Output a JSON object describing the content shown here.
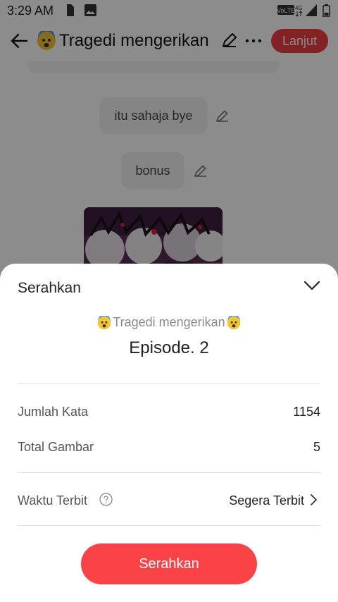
{
  "status_bar": {
    "time": "3:29 AM",
    "icons": [
      "sim-card-icon",
      "image-icon",
      "volte-icon",
      "4g-icon",
      "signal-icon",
      "battery-icon"
    ]
  },
  "header": {
    "title_emoji": "fearful-face-emoji",
    "title": "Tragedi mengerikan",
    "next_label": "Lanjut",
    "accent_color": "#ef3e44"
  },
  "content": {
    "items": [
      {
        "text": "itu sahaja bye"
      },
      {
        "text": "bonus"
      }
    ],
    "image": "anime-group-illustration"
  },
  "sheet": {
    "title": "Serahkan",
    "story_title": "Tragedi mengerikan",
    "episode": "Episode. 2",
    "stats": [
      {
        "label": "Jumlah Kata",
        "value": "1154"
      },
      {
        "label": "Total Gambar",
        "value": "5"
      }
    ],
    "publish": {
      "label": "Waktu Terbit",
      "value": "Segera Terbit"
    },
    "submit_label": "Serahkan",
    "button_color": "#fb4247"
  }
}
